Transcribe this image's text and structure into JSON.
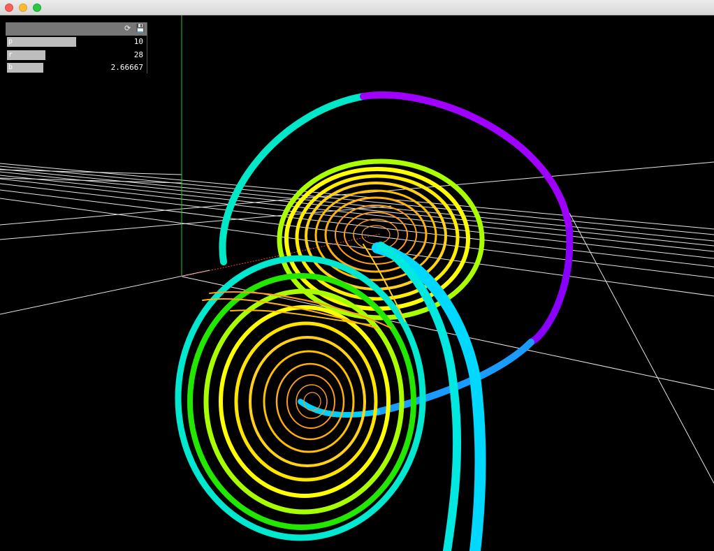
{
  "window": {
    "title": "",
    "buttons": [
      "close",
      "minimize",
      "zoom"
    ]
  },
  "gui": {
    "header_icons": [
      "refresh-icon",
      "save-icon"
    ],
    "sliders": [
      {
        "name": "p",
        "value": "10",
        "level": 0.48
      },
      {
        "name": "r",
        "value": "28",
        "level": 0.27
      },
      {
        "name": "b",
        "value": "2.66667",
        "level": 0.26
      }
    ]
  },
  "scene": {
    "description_visible": "Lorenz attractor rendered as colored 3D tube",
    "background": "#000000",
    "grid_color": "#ffffff",
    "y_axis_color": "#00ff00",
    "x_axis_color": "#ff4444",
    "tube_palette": [
      "#ff9a1a",
      "#ffd21a",
      "#ffff00",
      "#a8ff00",
      "#22e800",
      "#00e8c0",
      "#00d8ff",
      "#0a80ff",
      "#8a00ff",
      "#c000ff"
    ]
  }
}
